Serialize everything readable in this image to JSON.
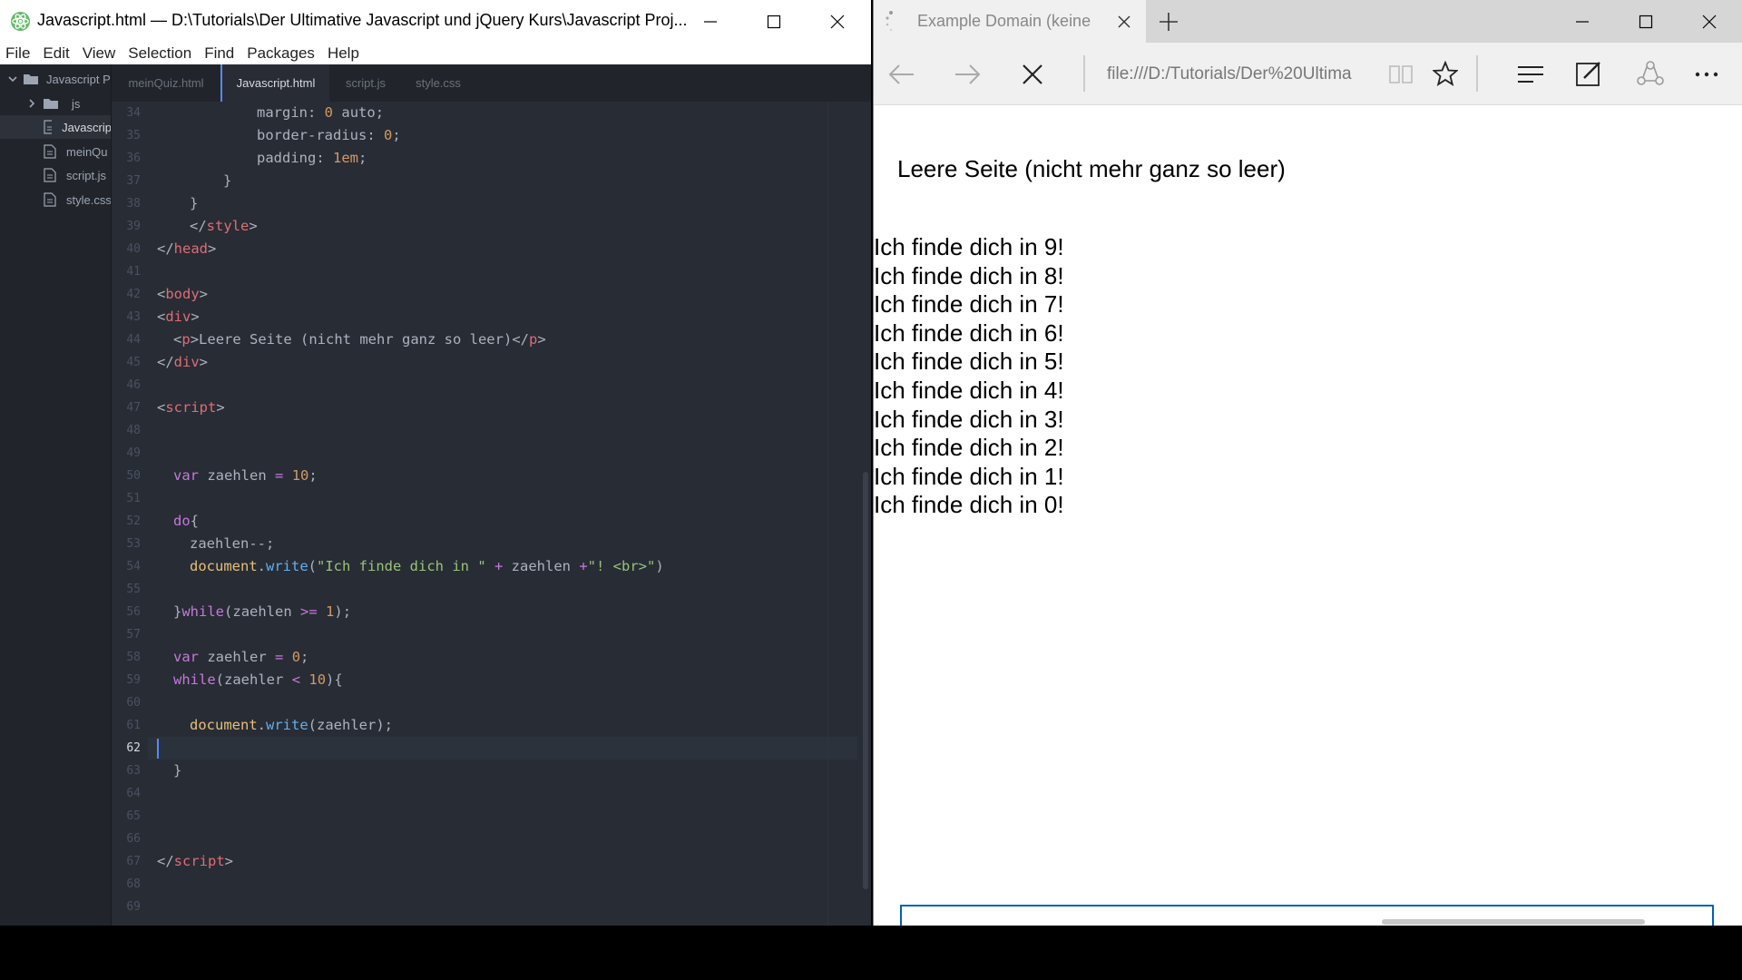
{
  "editor": {
    "title": "Javascript.html — D:\\Tutorials\\Der Ultimative Javascript und jQuery Kurs\\Javascript Proj...",
    "menu": [
      "File",
      "Edit",
      "View",
      "Selection",
      "Find",
      "Packages",
      "Help"
    ],
    "tree": {
      "root": "Javascript P",
      "items": [
        "js",
        "Javascrip",
        "meinQu",
        "script.js",
        "style.css"
      ]
    },
    "tabs": [
      "meinQuiz.html",
      "Javascript.html",
      "script.js",
      "style.css"
    ],
    "line_numbers": [
      "34",
      "35",
      "36",
      "37",
      "38",
      "39",
      "40",
      "41",
      "42",
      "43",
      "44",
      "45",
      "46",
      "47",
      "48",
      "49",
      "50",
      "51",
      "52",
      "53",
      "54",
      "55",
      "56",
      "57",
      "58",
      "59",
      "60",
      "61",
      "62",
      "63",
      "64",
      "65",
      "66",
      "67",
      "68",
      "69"
    ],
    "current_line": "62",
    "code": {
      "l34": "margin",
      "l34v": "0",
      "l34v2": "auto",
      "l35": "border-radius",
      "l35v": "0",
      "l36": "padding",
      "l36v": "1em",
      "style_tag": "style",
      "head_tag": "head",
      "body_tag": "body",
      "div_tag": "div",
      "p_tag": "p",
      "para_text": "Leere Seite (nicht mehr ganz so leer)",
      "script_tag": "script",
      "var_kw": "var",
      "zaehlen": "zaehlen",
      "ten": "10",
      "do_kw": "do",
      "decrement": "zaehlen--;",
      "document": "document",
      "write": "write",
      "str1": "\"Ich finde dich in \"",
      "plus": " + ",
      "str2": "\"! <br>\"",
      "while_kw": "while",
      "gte": ">=",
      "one": "1",
      "zaehler": "zaehler",
      "zero": "0",
      "lt": "<"
    }
  },
  "browser": {
    "tab_title": "Example Domain (keine",
    "address": "file:///D:/Tutorials/Der%20Ultima",
    "paragraph": "Leere Seite (nicht mehr ganz so leer)",
    "output_lines": [
      "Ich finde dich in 9!",
      "Ich finde dich in 8!",
      "Ich finde dich in 7!",
      "Ich finde dich in 6!",
      "Ich finde dich in 5!",
      "Ich finde dich in 4!",
      "Ich finde dich in 3!",
      "Ich finde dich in 2!",
      "Ich finde dich in 1!",
      "Ich finde dich in 0!"
    ]
  },
  "colors": {
    "editor_bg": "#282c34",
    "tag": "#e06c75",
    "keyword": "#c678dd",
    "number": "#d19a66",
    "string": "#98c379",
    "function": "#61afef",
    "accent": "#0063b1"
  }
}
